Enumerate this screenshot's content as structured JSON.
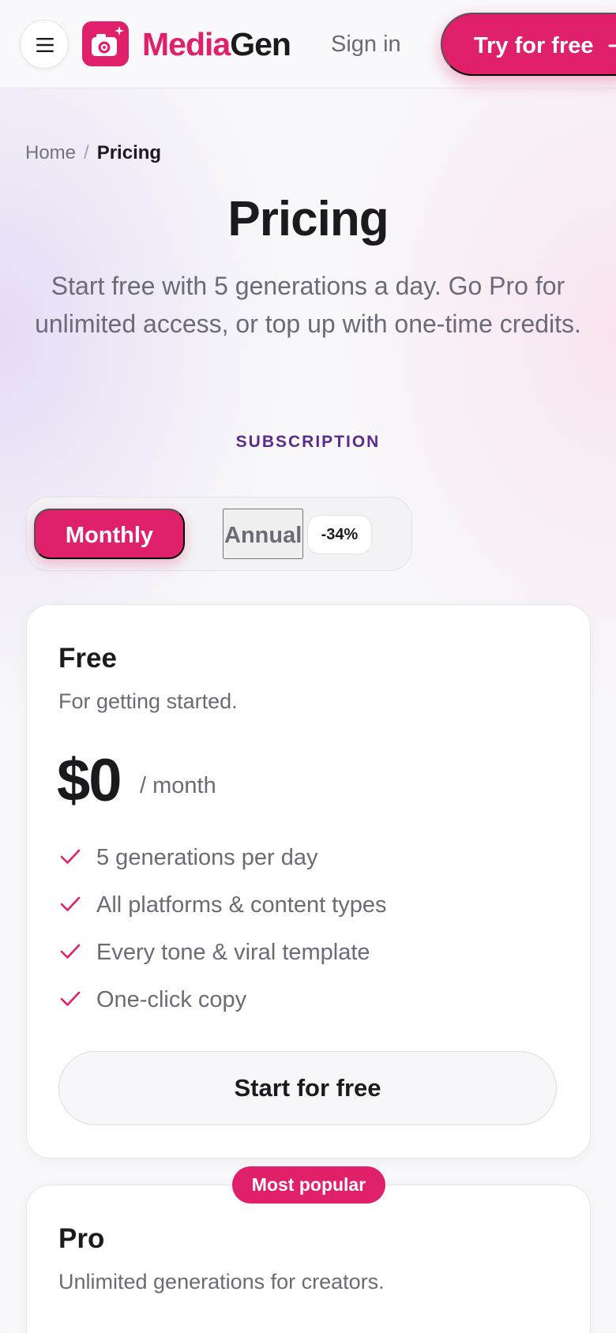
{
  "colors": {
    "accent": "#e0206a",
    "section_label": "#5b2a8a",
    "muted_text": "#6b6b78"
  },
  "header": {
    "menu_icon": "hamburger-icon",
    "logo_icon": "camera-sparkle-icon",
    "brand_part1": "Media",
    "brand_part2": "Gen",
    "sign_in": "Sign in",
    "try_free": "Try for free",
    "try_icon": "arrow-right-icon"
  },
  "breadcrumb": {
    "home": "Home",
    "separator": "/",
    "current": "Pricing"
  },
  "page": {
    "title": "Pricing",
    "subtitle": "Start free with 5 generations a day. Go Pro for unlimited access, or top up with one-time credits.",
    "section_label": "SUBSCRIPTION"
  },
  "billing_toggle": {
    "monthly": "Monthly",
    "annual": "Annual",
    "discount": "-34%",
    "selected": "Monthly"
  },
  "plans": [
    {
      "name": "Free",
      "description": "For getting started.",
      "price": "$0",
      "period": "/ month",
      "features": [
        "5 generations per day",
        "All platforms & content types",
        "Every tone & viral template",
        "One-click copy"
      ],
      "cta": "Start for free"
    },
    {
      "badge": "Most popular",
      "name": "Pro",
      "description": "Unlimited generations for creators."
    }
  ]
}
